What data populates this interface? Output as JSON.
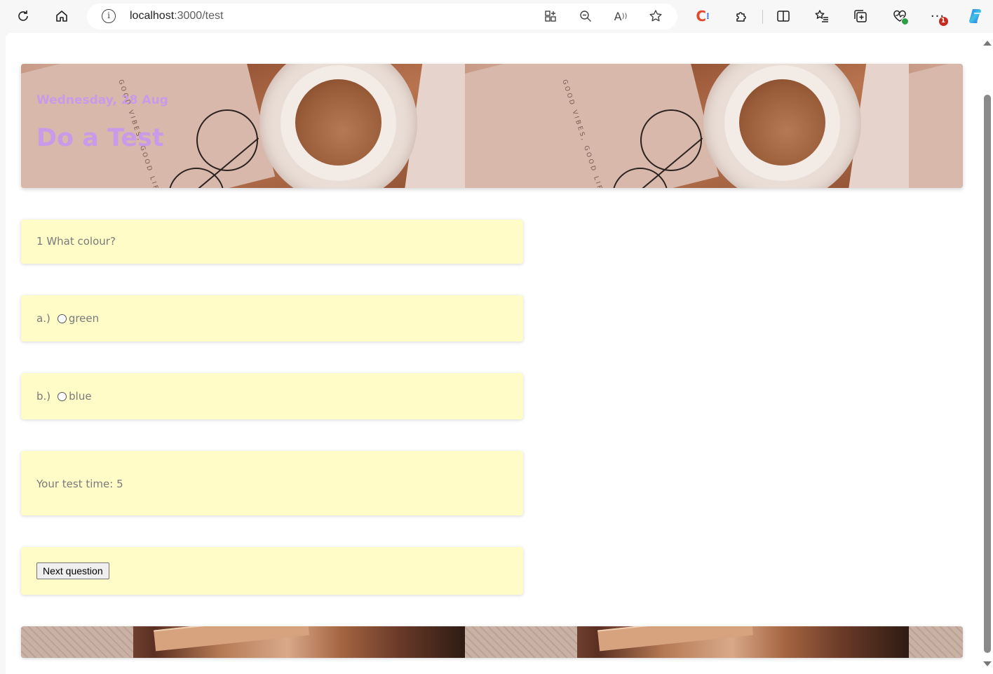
{
  "browser": {
    "url_host": "localhost",
    "url_path": ":3000/test",
    "notification_count": "1"
  },
  "header": {
    "date": "Wednesday, 28 Aug",
    "title": "Do a Test",
    "banner_text": "GOOD VIBES, GOOD LIFE"
  },
  "question": {
    "number": "1",
    "text": "What colour?"
  },
  "options": [
    {
      "letter": "a.)",
      "label": "green"
    },
    {
      "letter": "b.)",
      "label": "blue"
    }
  ],
  "timer": {
    "label": "Your test time:",
    "value": "5"
  },
  "actions": {
    "next_label": "Next question"
  },
  "colors": {
    "card_background": "#fffcc8",
    "header_text": "#c89be8"
  }
}
